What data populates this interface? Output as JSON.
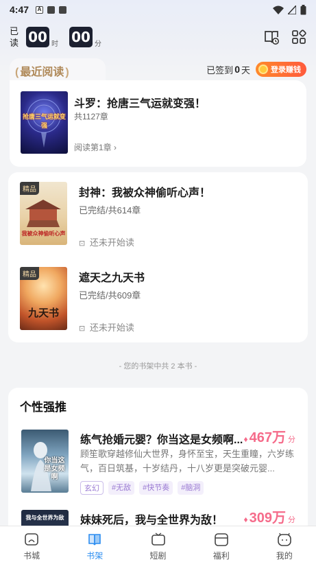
{
  "status_bar": {
    "time": "4:47",
    "a_icon": "A"
  },
  "header": {
    "read_label": "已读",
    "hours": "00",
    "hours_unit": "时",
    "minutes": "00",
    "minutes_unit": "分",
    "icons": [
      "book-clock-icon",
      "grid-icon"
    ]
  },
  "recent": {
    "tab_label": "最近阅读",
    "signin_prefix": "已签到",
    "signin_days": "0",
    "signin_suffix": "天",
    "earn_button": "登录赚钱",
    "book": {
      "title": "斗罗：抢唐三气运就变强！",
      "chapters": "共1127章",
      "progress": "阅读第1章",
      "cover_text": "抢唐三气运就变强"
    }
  },
  "shelf": {
    "books": [
      {
        "title": "封神：我被众神偷听心声！",
        "status": "已完结/共614章",
        "read_state": "还未开始读",
        "badge": "精品",
        "cover_text": "我被众神偷听心声"
      },
      {
        "title": "遮天之九天书",
        "status": "已完结/共609章",
        "read_state": "还未开始读",
        "badge": "精品",
        "cover_text": "九天书"
      }
    ],
    "count_text": "- 您的书架中共 2 本书 -"
  },
  "recommend": {
    "heading": "个性强推",
    "items": [
      {
        "title": "练气抢婚元婴？你当这是女频啊...",
        "score": "467万",
        "score_unit": "分",
        "desc": "顾笙歌穿越修仙大世界，身怀至宝，天生重瞳，六岁练气，百日筑基，十岁结丹，十八岁更是突破元婴...",
        "tags": [
          "玄幻",
          "#无敌",
          "#快节奏",
          "#脑洞"
        ],
        "cover_text": "你当这是女频啊"
      },
      {
        "title": "妹妹死后，我与全世界为敌！",
        "score": "309万",
        "score_unit": "分",
        "cover_text": "我与全世界为敌"
      }
    ]
  },
  "nav": {
    "items": [
      {
        "label": "书城",
        "icon": "store-icon"
      },
      {
        "label": "书架",
        "icon": "bookshelf-icon"
      },
      {
        "label": "短剧",
        "icon": "tv-icon"
      },
      {
        "label": "福利",
        "icon": "gift-icon"
      },
      {
        "label": "我的",
        "icon": "profile-icon"
      }
    ],
    "active_index": 1
  },
  "colors": {
    "accent": "#2a8cf0",
    "score": "#f56b8a",
    "tag": "#9b7bd3",
    "earn": "#ff6a35"
  }
}
